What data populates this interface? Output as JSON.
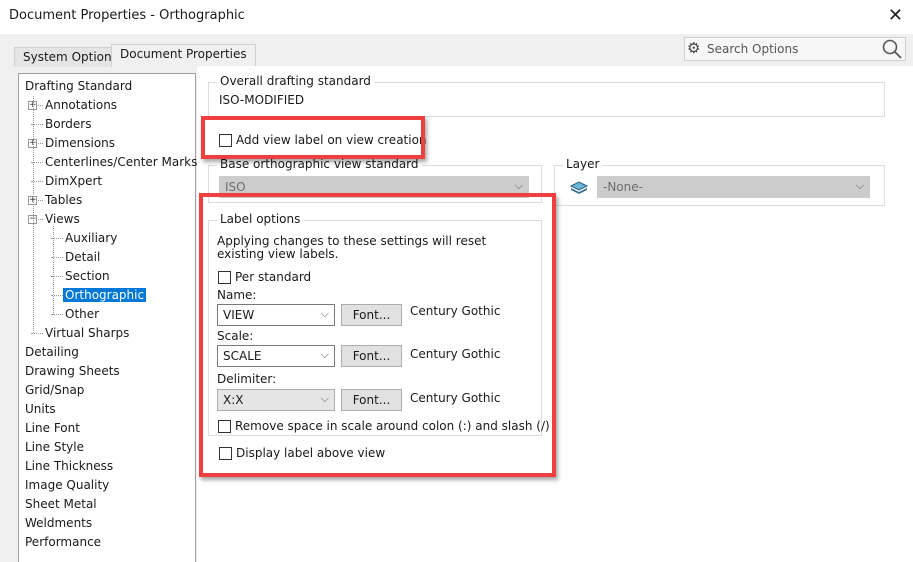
{
  "window": {
    "title": "Document Properties - Orthographic",
    "close_icon": "close-icon"
  },
  "tabs": [
    {
      "label": "System Options",
      "active": false
    },
    {
      "label": "Document Properties",
      "active": true
    }
  ],
  "search": {
    "placeholder": "Search Options",
    "gear_icon": "gear-icon",
    "search_icon": "magnifier-icon"
  },
  "tree": {
    "items": [
      {
        "label": "Drafting Standard",
        "level": 0,
        "expander": null
      },
      {
        "label": "Annotations",
        "level": 1,
        "expander": "+"
      },
      {
        "label": "Borders",
        "level": 1,
        "expander": null
      },
      {
        "label": "Dimensions",
        "level": 1,
        "expander": "+"
      },
      {
        "label": "Centerlines/Center Marks",
        "level": 1,
        "expander": null
      },
      {
        "label": "DimXpert",
        "level": 1,
        "expander": null
      },
      {
        "label": "Tables",
        "level": 1,
        "expander": "+"
      },
      {
        "label": "Views",
        "level": 1,
        "expander": "-"
      },
      {
        "label": "Auxiliary",
        "level": 2,
        "expander": null
      },
      {
        "label": "Detail",
        "level": 2,
        "expander": null
      },
      {
        "label": "Section",
        "level": 2,
        "expander": null
      },
      {
        "label": "Orthographic",
        "level": 2,
        "expander": null,
        "selected": true
      },
      {
        "label": "Other",
        "level": 2,
        "expander": null
      },
      {
        "label": "Virtual Sharps",
        "level": 1,
        "expander": null
      },
      {
        "label": "Detailing",
        "level": 0,
        "expander": null
      },
      {
        "label": "Drawing Sheets",
        "level": 0,
        "expander": null
      },
      {
        "label": "Grid/Snap",
        "level": 0,
        "expander": null
      },
      {
        "label": "Units",
        "level": 0,
        "expander": null
      },
      {
        "label": "Line Font",
        "level": 0,
        "expander": null
      },
      {
        "label": "Line Style",
        "level": 0,
        "expander": null
      },
      {
        "label": "Line Thickness",
        "level": 0,
        "expander": null
      },
      {
        "label": "Image Quality",
        "level": 0,
        "expander": null
      },
      {
        "label": "Sheet Metal",
        "level": 0,
        "expander": null
      },
      {
        "label": "Weldments",
        "level": 0,
        "expander": null
      },
      {
        "label": "Performance",
        "level": 0,
        "expander": null
      }
    ]
  },
  "main": {
    "overall": {
      "title": "Overall drafting standard",
      "value": "ISO-MODIFIED"
    },
    "add_view_label": {
      "label": "Add view label on view creation",
      "checked": false
    },
    "base_standard": {
      "title": "Base orthographic view standard",
      "value": "ISO"
    },
    "layer": {
      "title": "Layer",
      "value": "-None-",
      "icon": "layers-icon"
    },
    "label_options": {
      "title": "Label options",
      "note": "Applying changes to these settings will reset existing view labels.",
      "per_standard": {
        "label": "Per standard",
        "checked": false
      },
      "name": {
        "label": "Name:",
        "value": "VIEW",
        "font_button": "Font...",
        "font": "Century Gothic"
      },
      "scale": {
        "label": "Scale:",
        "value": "SCALE",
        "font_button": "Font...",
        "font": "Century Gothic"
      },
      "delimiter": {
        "label": "Delimiter:",
        "value": "X:X",
        "font_button": "Font...",
        "font": "Century Gothic"
      },
      "remove_space": {
        "label": "Remove space in scale around colon (:) and slash (/)",
        "checked": false
      }
    },
    "display_above": {
      "label": "Display label above view",
      "checked": false
    }
  },
  "colors": {
    "highlight": "#ef3f3f",
    "selection": "#0078d7"
  }
}
